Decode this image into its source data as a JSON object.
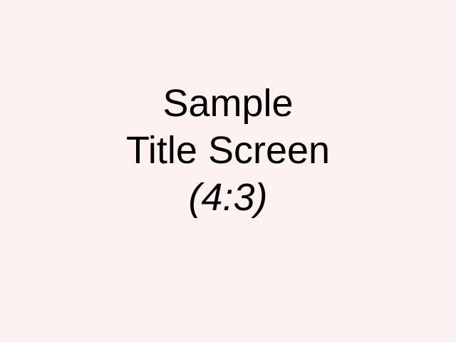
{
  "title_screen": {
    "line1": "Sample",
    "line2": "Title Screen",
    "line3": "(4:3)"
  },
  "colors": {
    "background": "#FDF1F1",
    "text": "#000000"
  }
}
